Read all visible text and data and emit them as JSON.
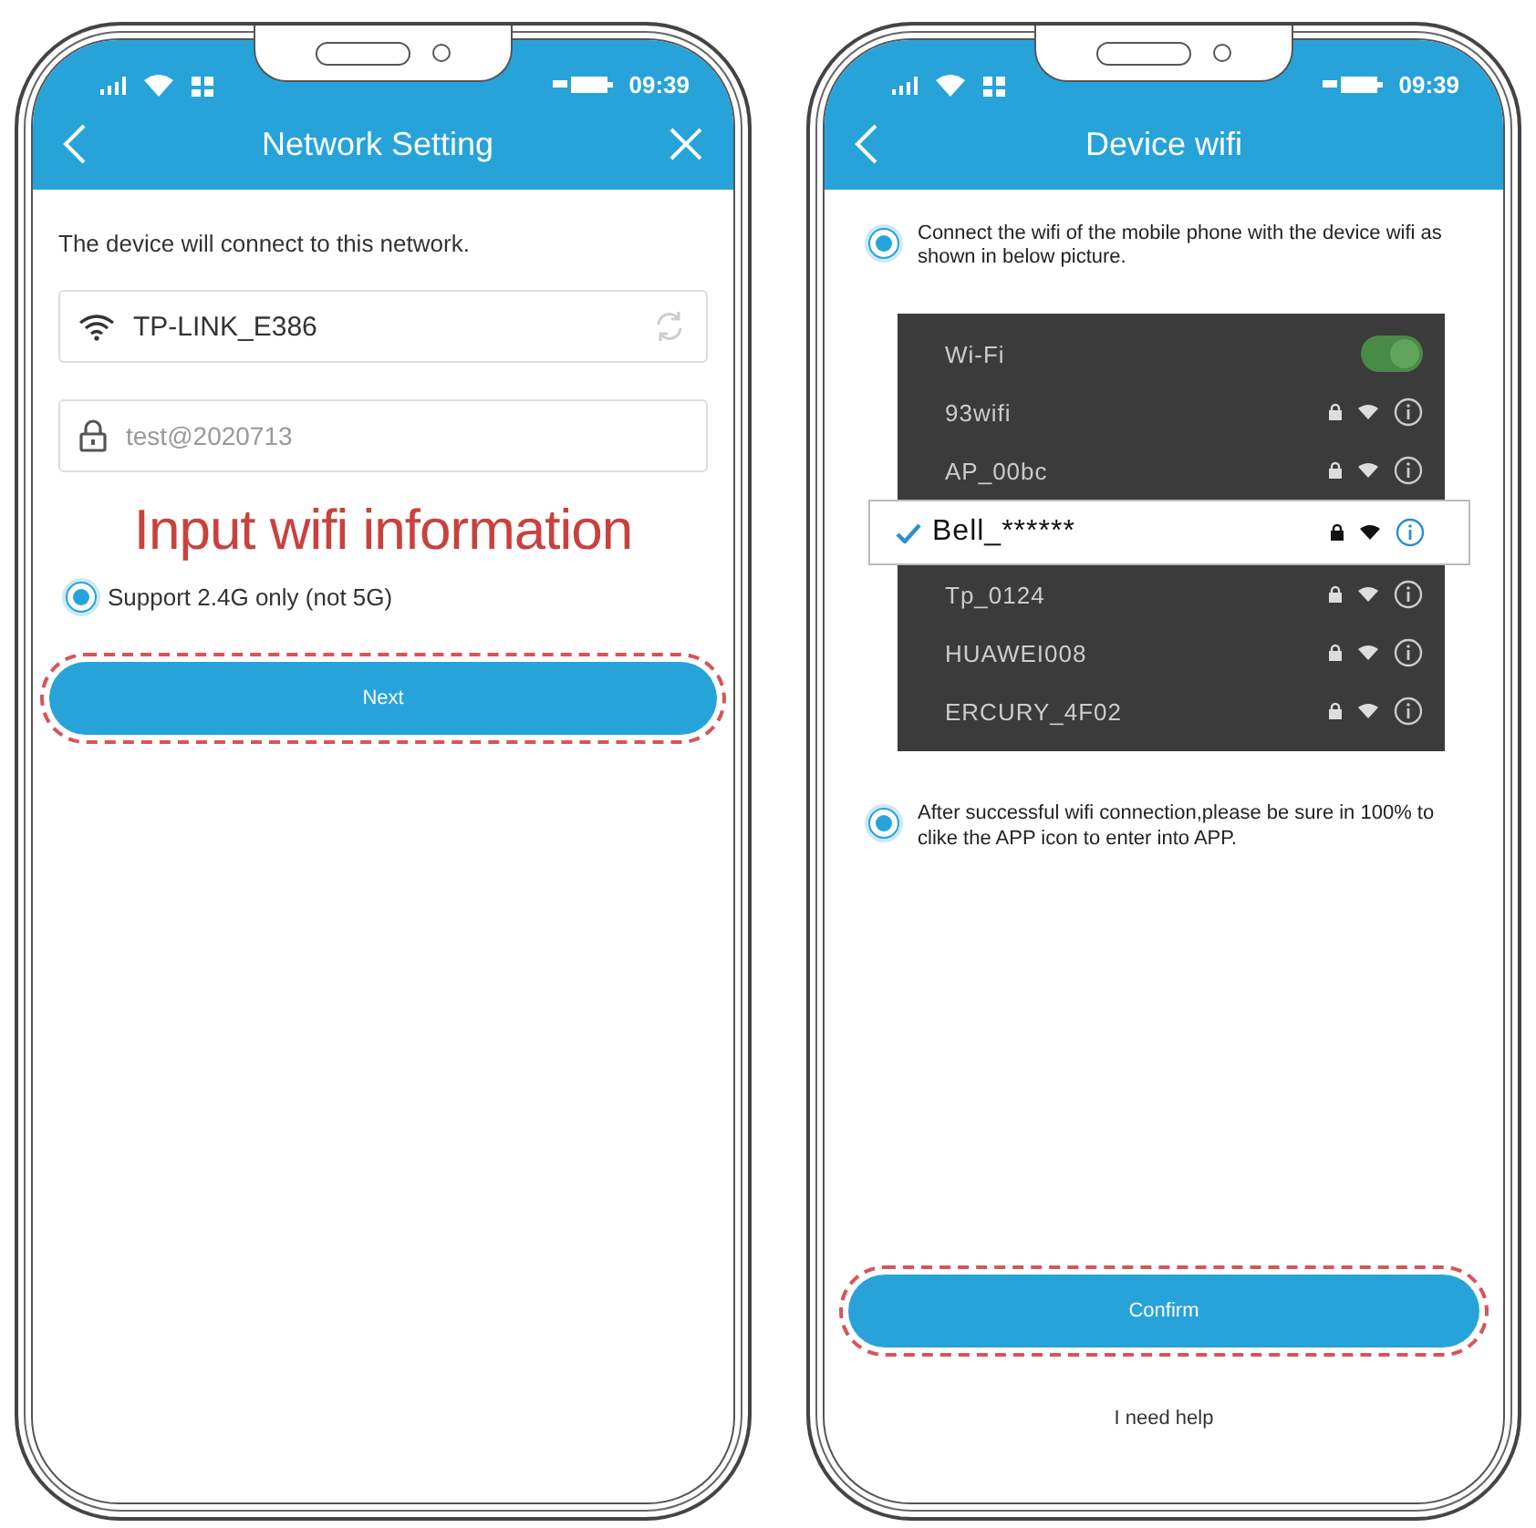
{
  "left_phone": {
    "status_time": "09:39",
    "title": "Network Setting",
    "intro": "The device will connect to this network.",
    "network_field": {
      "value": "TP-LINK_E386"
    },
    "password_field": {
      "value": "test@2020713"
    },
    "annotation": "Input wifi information",
    "option": {
      "label": "Support 2.4G only (not 5G)",
      "selected": true
    },
    "next_button": "Next"
  },
  "right_phone": {
    "status_time": "09:39",
    "title": "Device wifi",
    "steps": [
      {
        "text": "Connect the wifi of the mobile phone with the device wifi as shown in below picture.",
        "selected": true
      },
      {
        "text": "After successful wifi connection,please be sure in 100% to clike the APP icon to enter into APP.",
        "selected": true
      }
    ],
    "wifi_list": {
      "header": "Wi-Fi",
      "on": true,
      "networks": [
        {
          "name": "93wifi",
          "selected": false
        },
        {
          "name": "AP_00bc",
          "selected": false
        },
        {
          "name": "Bell_******",
          "selected": true
        },
        {
          "name": "Tp_0124",
          "selected": false
        },
        {
          "name": "HUAWEI008",
          "selected": false
        },
        {
          "name": "ERCURY_4F02",
          "selected": false
        }
      ]
    },
    "confirm_button": "Confirm",
    "help_link": "I need help"
  }
}
